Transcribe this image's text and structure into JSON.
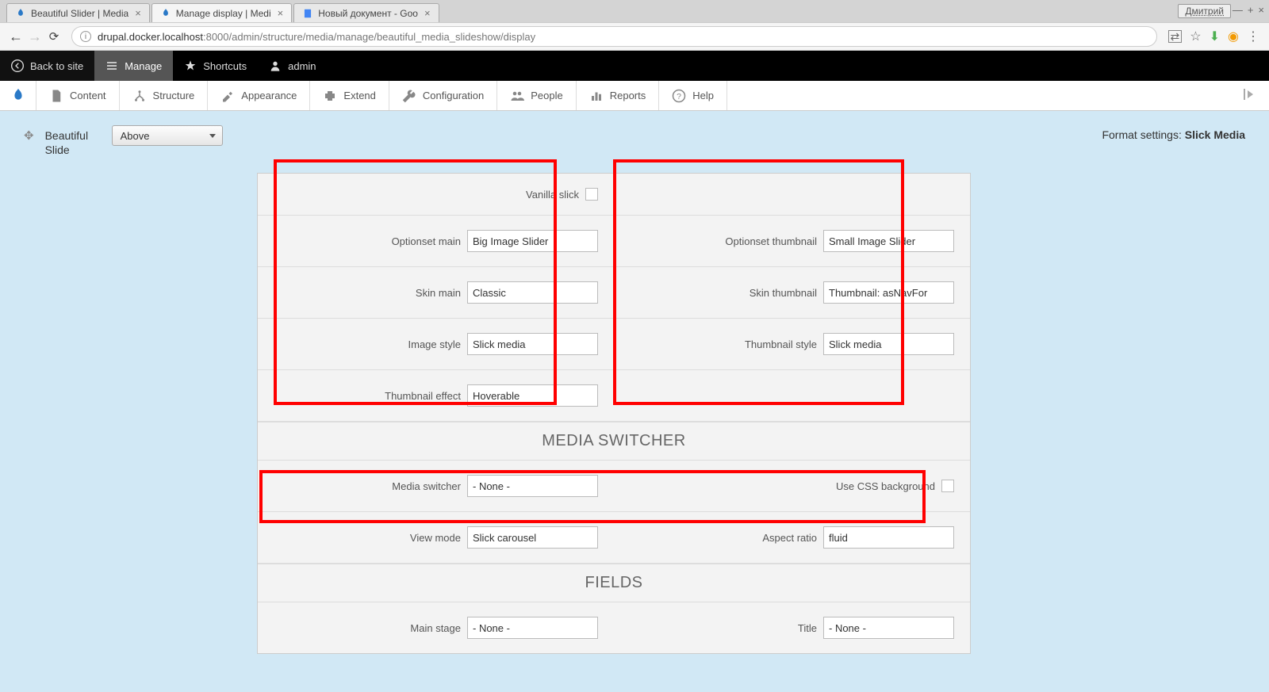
{
  "browser": {
    "tabs": [
      {
        "title": "Beautiful Slider | Media",
        "active": false
      },
      {
        "title": "Manage display | Medi",
        "active": true
      },
      {
        "title": "Новый документ - Goo",
        "active": false
      }
    ],
    "user": "Дмитрий",
    "url_host": "drupal.docker.localhost",
    "url_path": ":8000/admin/structure/media/manage/beautiful_media_slideshow/display"
  },
  "toolbar": {
    "back_to_site": "Back to site",
    "manage": "Manage",
    "shortcuts": "Shortcuts",
    "admin": "admin"
  },
  "admin_menu": {
    "content": "Content",
    "structure": "Structure",
    "appearance": "Appearance",
    "extend": "Extend",
    "configuration": "Configuration",
    "people": "People",
    "reports": "Reports",
    "help": "Help"
  },
  "field": {
    "name": "Beautiful Slide",
    "label_position": "Above",
    "format_settings_label": "Format settings: ",
    "format_settings_value": "Slick Media"
  },
  "settings": {
    "vanilla_slick_label": "Vanilla slick",
    "optionset_main_label": "Optionset main",
    "optionset_main_value": "Big Image Slider",
    "optionset_thumbnail_label": "Optionset thumbnail",
    "optionset_thumbnail_value": "Small Image Slider",
    "skin_main_label": "Skin main",
    "skin_main_value": "Classic",
    "skin_thumbnail_label": "Skin thumbnail",
    "skin_thumbnail_value": "Thumbnail: asNavFor",
    "image_style_label": "Image style",
    "image_style_value": "Slick media",
    "thumbnail_style_label": "Thumbnail style",
    "thumbnail_style_value": "Slick media",
    "thumbnail_effect_label": "Thumbnail effect",
    "thumbnail_effect_value": "Hoverable",
    "media_switcher_header": "MEDIA SWITCHER",
    "media_switcher_label": "Media switcher",
    "media_switcher_value": "- None -",
    "use_css_bg_label": "Use CSS background",
    "view_mode_label": "View mode",
    "view_mode_value": "Slick carousel",
    "aspect_ratio_label": "Aspect ratio",
    "aspect_ratio_value": "fluid",
    "fields_header": "FIELDS",
    "main_stage_label": "Main stage",
    "main_stage_value": "- None -",
    "title_label": "Title",
    "title_value": "- None -"
  }
}
